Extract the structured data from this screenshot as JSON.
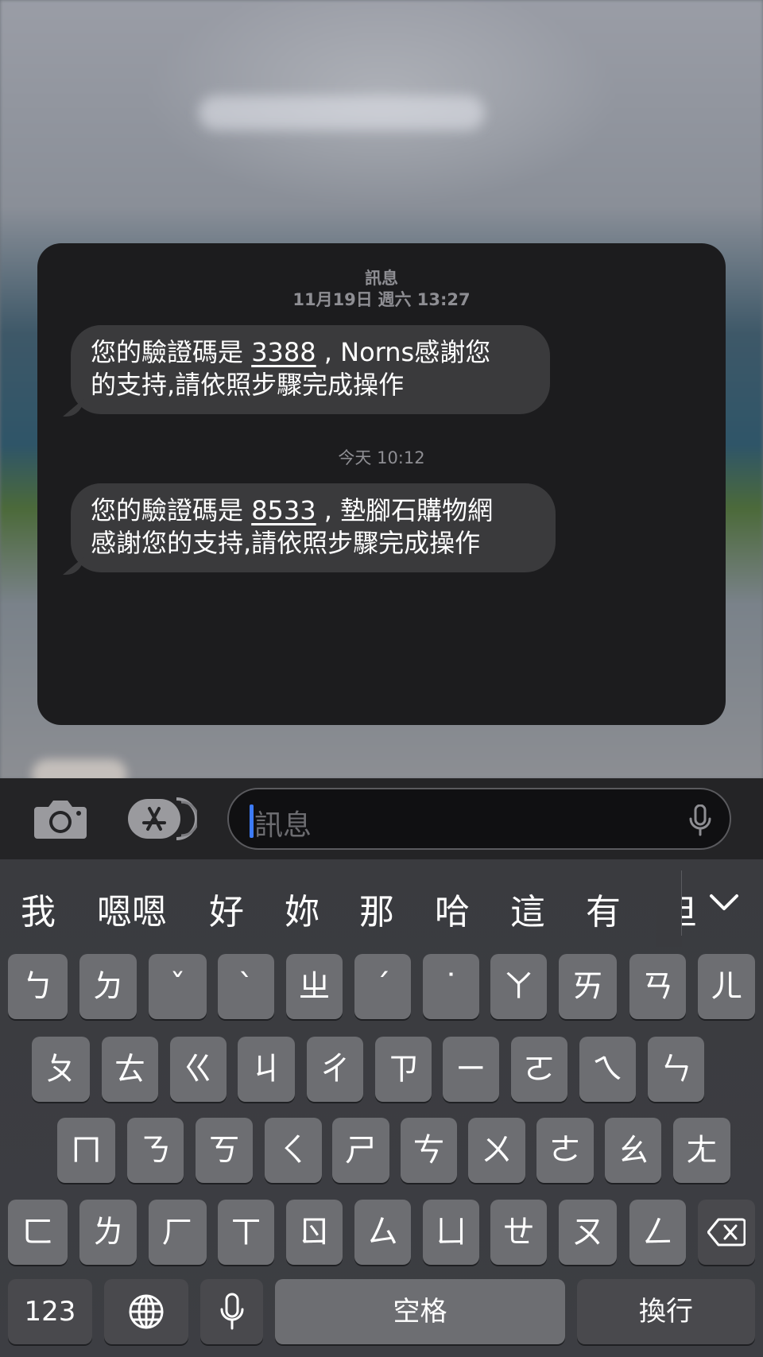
{
  "card": {
    "app_name": "訊息",
    "messages": [
      {
        "date": "11月19日",
        "weekday_time": "週六 13:27",
        "line1_prefix": "您的驗證碼是 ",
        "code": "3388",
        "line1_suffix": " , Norns感謝您",
        "line2": "的支持,請依照步驟完成操作"
      },
      {
        "date": "今天",
        "weekday_time": "10:12",
        "line1_prefix": "您的驗證碼是 ",
        "code": "8533",
        "line1_suffix": " , 墊腳石購物網",
        "line2": "感謝您的支持,請依照步驟完成操作"
      }
    ]
  },
  "input_bar": {
    "camera_icon": "camera-icon",
    "apps_icon": "app-store-icon",
    "placeholder": "訊息",
    "mic_icon": "microphone-icon"
  },
  "keyboard": {
    "suggestions": [
      "我",
      "嗯嗯",
      "好",
      "妳",
      "那",
      "哈",
      "這",
      "有",
      "但"
    ],
    "row1": [
      "ㄅ",
      "ㄉ",
      "ˇ",
      "ˋ",
      "ㄓ",
      "ˊ",
      "˙",
      "ㄚ",
      "ㄞ",
      "ㄢ",
      "ㄦ"
    ],
    "row2": [
      "ㄆ",
      "ㄊ",
      "ㄍ",
      "ㄐ",
      "ㄔ",
      "ㄗ",
      "ㄧ",
      "ㄛ",
      "ㄟ",
      "ㄣ"
    ],
    "row3": [
      "ㄇ",
      "ㄋ",
      "ㄎ",
      "ㄑ",
      "ㄕ",
      "ㄘ",
      "ㄨ",
      "ㄜ",
      "ㄠ",
      "ㄤ"
    ],
    "row4": [
      "ㄈ",
      "ㄌ",
      "ㄏ",
      "ㄒ",
      "ㄖ",
      "ㄙ",
      "ㄩ",
      "ㄝ",
      "ㄡ",
      "ㄥ"
    ],
    "delete_icon": "delete-backspace-icon",
    "numbers_label": "123",
    "globe_icon": "globe-icon",
    "dictation_icon": "microphone-icon",
    "space_label": "空格",
    "return_label": "換行",
    "collapse_icon": "chevron-down-icon"
  }
}
